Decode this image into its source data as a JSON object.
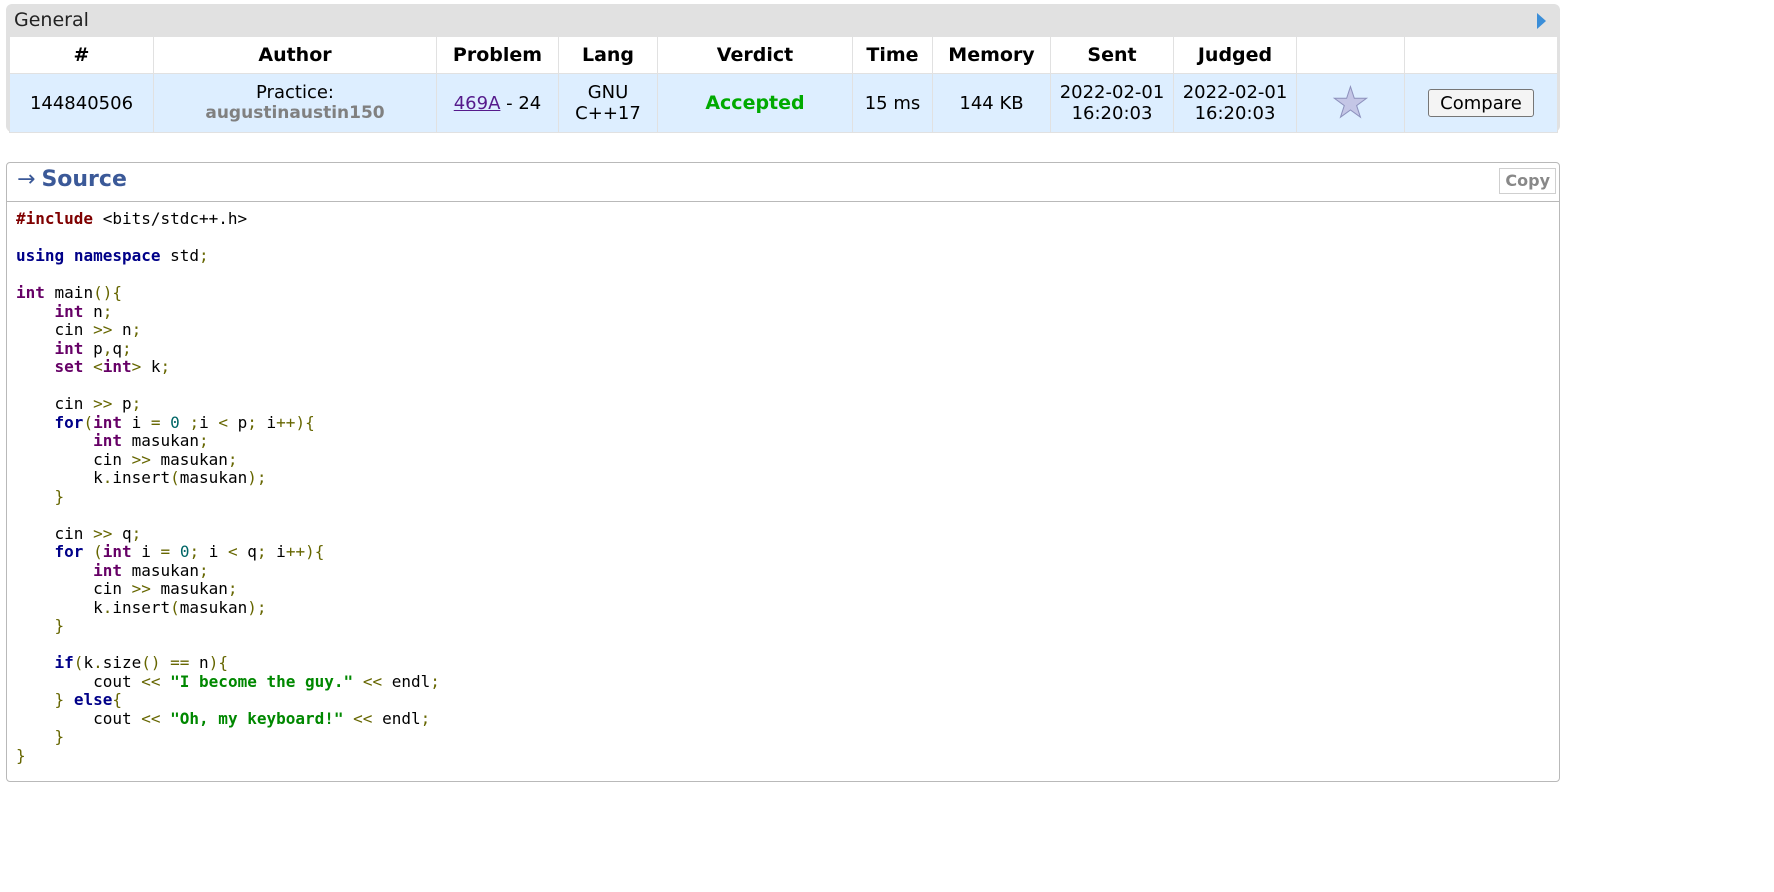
{
  "general": {
    "title": "General",
    "columns": [
      "#",
      "Author",
      "Problem",
      "Lang",
      "Verdict",
      "Time",
      "Memory",
      "Sent",
      "Judged",
      "",
      ""
    ],
    "row": {
      "id": "144840506",
      "author_prefix": "Practice:",
      "author_handle": "augustinaustin150",
      "problem_link": "469A",
      "problem_suffix": " - 24",
      "lang_line1": "GNU",
      "lang_line2": "C++17",
      "verdict": "Accepted",
      "time": "15 ms",
      "memory": "144 KB",
      "sent_date": "2022-02-01",
      "sent_time": "16:20:03",
      "judged_date": "2022-02-01",
      "judged_time": "16:20:03",
      "favourite_icon": "star-icon",
      "compare_label": "Compare"
    }
  },
  "source": {
    "arrow": "→",
    "title": "Source",
    "copy_label": "Copy",
    "code_lines": [
      "#include <bits/stdc++.h>",
      "",
      "using namespace std;",
      "",
      "int main(){",
      "    int n;",
      "    cin >> n;",
      "    int p,q;",
      "    set <int> k;",
      "",
      "    cin >> p;",
      "    for(int i = 0 ;i < p; i++){",
      "        int masukan;",
      "        cin >> masukan;",
      "        k.insert(masukan);",
      "    }",
      "",
      "    cin >> q;",
      "    for (int i = 0; i < q; i++){",
      "        int masukan;",
      "        cin >> masukan;",
      "        k.insert(masukan);",
      "    }",
      "",
      "    if(k.size() == n){",
      "        cout << \"I become the guy.\" << endl;",
      "    } else{",
      "        cout << \"Oh, my keyboard!\" << endl;",
      "    }",
      "}"
    ]
  },
  "colors": {
    "verdict_accepted": "#00aa00",
    "row_background": "#ddeeff",
    "source_title": "#3b5998",
    "keyword": "#000088",
    "type": "#660066",
    "string": "#008800"
  }
}
